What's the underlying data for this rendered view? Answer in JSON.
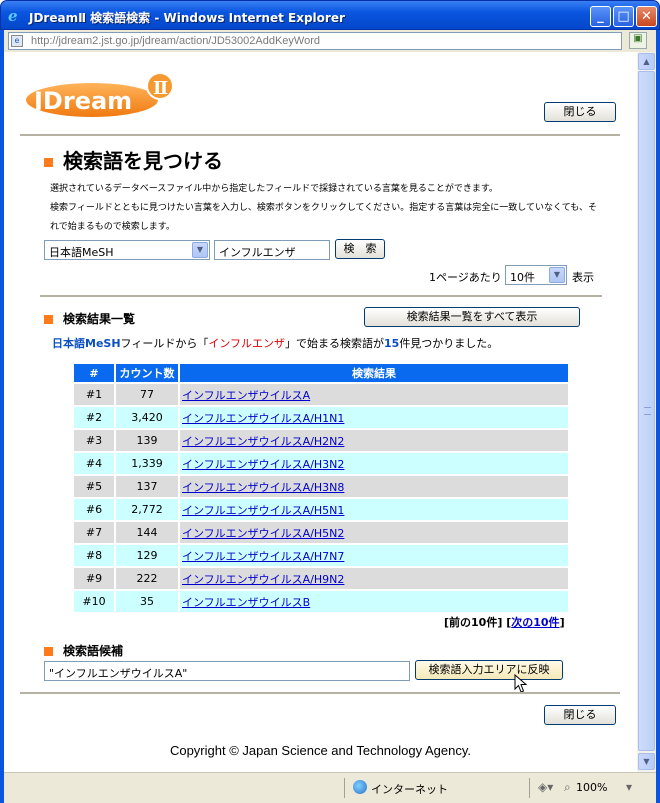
{
  "window": {
    "title": "JDreamⅡ 検索語検索 - Windows Internet Explorer",
    "url": "http://jdream2.jst.go.jp/jdream/action/JD53002AddKeyWord",
    "min": "_",
    "max": "□",
    "close": "✕"
  },
  "status": {
    "zone": "インターネット",
    "zoom": "100%"
  },
  "header": {
    "close_label": "閉じる"
  },
  "search": {
    "title": "検索語を見つける",
    "desc1": "選択されているデータベースファイル中から指定したフィールドで採録されている言葉を見ることができます。",
    "desc2": "検索フィールドとともに見つけたい言葉を入力し、検索ボタンをクリックしてください。指定する言葉は完全に一致していなくても、そ",
    "desc3": "れで始まるもので検索します。",
    "field_value": "日本語MeSH",
    "keyword_value": "インフルエンザ",
    "search_button": "検　索",
    "per_page_label": "1ページあたり",
    "per_page_value": "10件",
    "display_label": "表示"
  },
  "results": {
    "heading": "検索結果一覧",
    "show_all_button": "検索結果一覧をすべて表示",
    "found_field": "日本語MeSH",
    "found_t1": "フィールドから「",
    "found_keyword": "インフルエンザ",
    "found_t2": "」で始まる検索語が",
    "found_count": "15",
    "found_t3": "件見つかりました。",
    "columns": [
      "#",
      "カウント数",
      "検索結果"
    ],
    "rows": [
      {
        "num": "#1",
        "count": "77",
        "term": "インフルエンザウイルスA"
      },
      {
        "num": "#2",
        "count": "3,420",
        "term": "インフルエンザウイルスA/H1N1"
      },
      {
        "num": "#3",
        "count": "139",
        "term": "インフルエンザウイルスA/H2N2"
      },
      {
        "num": "#4",
        "count": "1,339",
        "term": "インフルエンザウイルスA/H3N2"
      },
      {
        "num": "#5",
        "count": "137",
        "term": "インフルエンザウイルスA/H3N8"
      },
      {
        "num": "#6",
        "count": "2,772",
        "term": "インフルエンザウイルスA/H5N1"
      },
      {
        "num": "#7",
        "count": "144",
        "term": "インフルエンザウイルスA/H5N2"
      },
      {
        "num": "#8",
        "count": "129",
        "term": "インフルエンザウイルスA/H7N7"
      },
      {
        "num": "#9",
        "count": "222",
        "term": "インフルエンザウイルスA/H9N2"
      },
      {
        "num": "#10",
        "count": "35",
        "term": "インフルエンザウイルスB"
      }
    ],
    "prev": "[前の10件]",
    "next_open": "[",
    "next": "次の10件",
    "next_close": "]"
  },
  "candidate": {
    "heading": "検索語候補",
    "value": "\"インフルエンザウイルスA\"",
    "apply_button": "検索語入力エリアに反映"
  },
  "footer": {
    "close_label": "閉じる",
    "copyright": "Copyright © Japan Science and Technology Agency."
  },
  "colors": {
    "accent": "#ff7a1a",
    "table_header": "#0a6aef",
    "row_odd": "#dcdcdc",
    "row_even": "#ccffff"
  },
  "logo": {
    "text": "JDream",
    "mark": "Ⅱ"
  }
}
